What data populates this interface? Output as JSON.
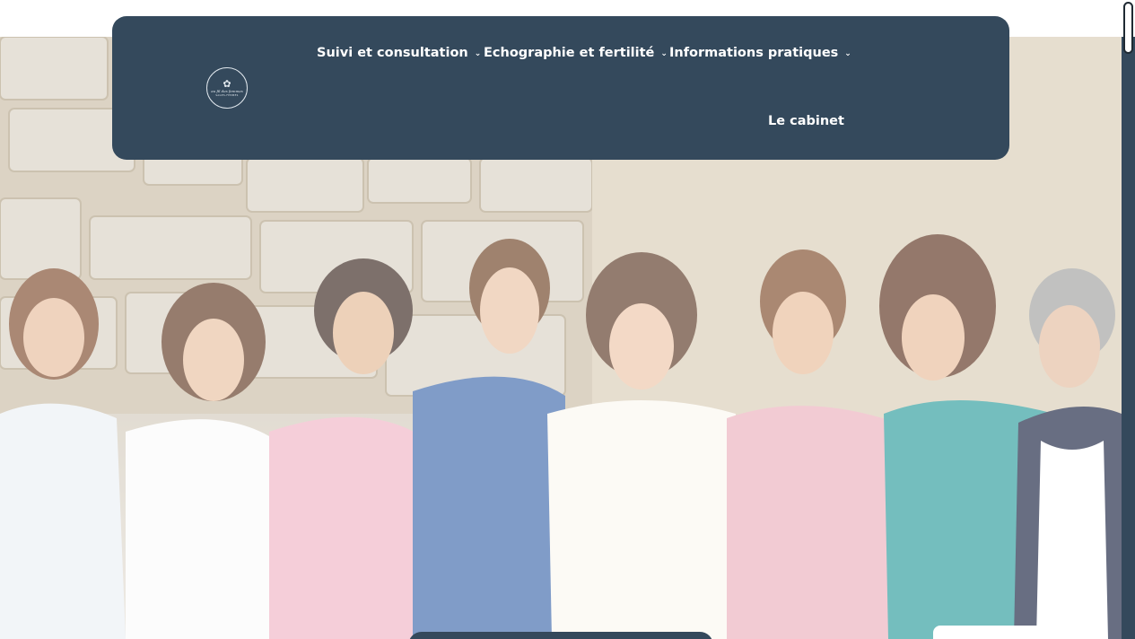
{
  "nav": {
    "items": [
      {
        "label": "Suivi et consultation",
        "has_dropdown": true
      },
      {
        "label": "Echographie et fertilité",
        "has_dropdown": true
      },
      {
        "label": "Informations pratiques",
        "has_dropdown": true
      },
      {
        "label": "Le cabinet",
        "has_dropdown": false
      }
    ],
    "chevron_icon": "chevron-down-icon"
  },
  "logo": {
    "text": "au fil des femmes",
    "subtext": "SAGES-FEMMES"
  },
  "hero": {
    "description_icon": "team-photo"
  },
  "colors": {
    "header_bg": "#34495c",
    "nav_text": "#ffffff",
    "page_bg": "#ffffff"
  }
}
